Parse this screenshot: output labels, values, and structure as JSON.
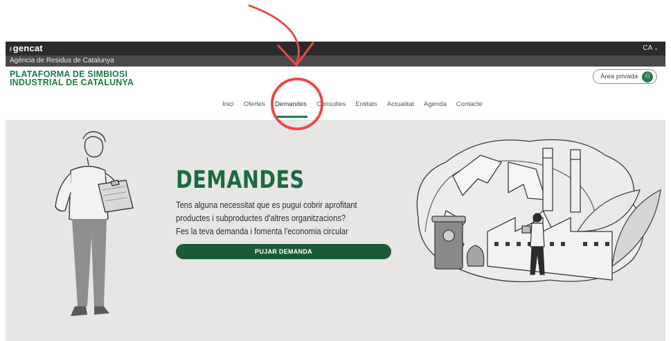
{
  "topbar": {
    "brand": "gencat",
    "language": "CA"
  },
  "agency": {
    "name": "Agència de Residus de Catalunya"
  },
  "header": {
    "logo_line1": "PLATAFORMA DE SIMBIOSI",
    "logo_line2": "INDUSTRIAL DE CATALUNYA",
    "private_area_label": "Àrea privada"
  },
  "nav": {
    "items": [
      {
        "label": "Inici"
      },
      {
        "label": "Ofertes"
      },
      {
        "label": "Demandes"
      },
      {
        "label": "Consultes"
      },
      {
        "label": "Entitats"
      },
      {
        "label": "Actualitat"
      },
      {
        "label": "Agenda"
      },
      {
        "label": "Contacte"
      }
    ],
    "active": "Demandes"
  },
  "hero": {
    "title": "DEMANDES",
    "line1": "Tens alguna necessitat que es pugui cobrir aprofitant",
    "line2": "productes i subproductes d'altres organitzacions?",
    "line3": "Fes la teva demanda i fomenta l'economia circular",
    "cta_label": "PUJAR DEMANDA"
  },
  "colors": {
    "brand_green": "#1f7a48",
    "button_green": "#1d5a37",
    "annotation_red": "#e84b4b",
    "hero_bg": "#e7e6e5"
  }
}
